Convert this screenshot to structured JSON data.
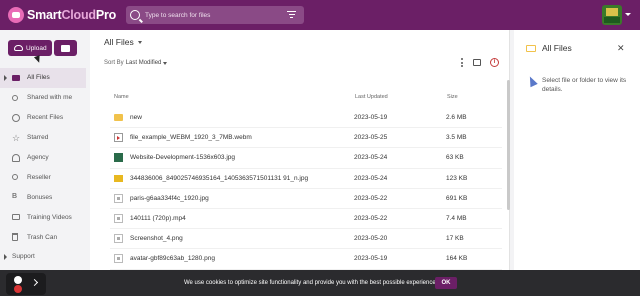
{
  "app": {
    "logo_prefix": "Smart",
    "logo_cloud": "Cloud",
    "logo_suffix": "Pro"
  },
  "search": {
    "placeholder": "Type to search for files"
  },
  "sidebar": {
    "upload_label": "Upload",
    "items": [
      {
        "label": "All Files",
        "icon": "folder-icon",
        "active": true
      },
      {
        "label": "Shared with me",
        "icon": "people-icon"
      },
      {
        "label": "Recent Files",
        "icon": "clock-icon"
      },
      {
        "label": "Starred",
        "icon": "star-icon"
      },
      {
        "label": "Agency",
        "icon": "agency-icon"
      },
      {
        "label": "Reseller",
        "icon": "reseller-icon"
      },
      {
        "label": "Bonuses",
        "icon": "bonus-icon"
      },
      {
        "label": "Training Videos",
        "icon": "video-icon"
      },
      {
        "label": "Trash Can",
        "icon": "trash-icon"
      },
      {
        "label": "Support",
        "icon": "help-icon"
      }
    ]
  },
  "main": {
    "title": "All Files",
    "sort_prefix": "Sort By",
    "sort_value": "Last Modified",
    "columns": {
      "name": "Name",
      "updated": "Last Updated",
      "size": "Size"
    },
    "files": [
      {
        "name": "new",
        "date": "2023-05-19",
        "size": "2.6 MB",
        "type": "folder"
      },
      {
        "name": "file_example_WEBM_1920_3_7MB.webm",
        "date": "2023-05-25",
        "size": "3.5 MB",
        "type": "video"
      },
      {
        "name": "Website-Development-1536x603.jpg",
        "date": "2023-05-24",
        "size": "63 KB",
        "type": "web"
      },
      {
        "name": "344836006_849025746935164_1405363571501131 91_n.jpg",
        "date": "2023-05-24",
        "size": "123 KB",
        "type": "photo"
      },
      {
        "name": "paris-g6aa334f4c_1920.jpg",
        "date": "2023-05-22",
        "size": "691 KB",
        "type": "doc"
      },
      {
        "name": "140111 (720p).mp4",
        "date": "2023-05-22",
        "size": "7.4 MB",
        "type": "doc"
      },
      {
        "name": "Screenshot_4.png",
        "date": "2023-05-20",
        "size": "17 KB",
        "type": "doc"
      },
      {
        "name": "avatar-gbf89c63ab_1280.png",
        "date": "2023-05-19",
        "size": "164 KB",
        "type": "doc"
      }
    ]
  },
  "details": {
    "title": "All Files",
    "hint": "Select file or folder to view its details."
  },
  "cookie": {
    "text": "We use cookies to optimize site functionality and provide you with the best possible experience.",
    "ok_label": "OK"
  }
}
